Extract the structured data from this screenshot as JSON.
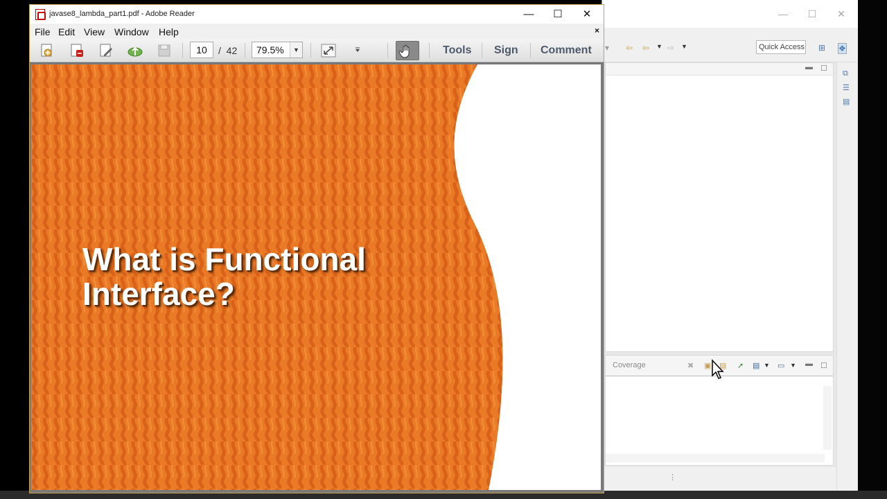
{
  "eclipse": {
    "quick_access": "Quick Access",
    "coverage_tab": "Coverage",
    "window_controls": {
      "minimize": "—",
      "maximize": "☐",
      "close": "✕"
    }
  },
  "reader": {
    "title": "javase8_lambda_part1.pdf - Adobe Reader",
    "window_controls": {
      "minimize": "—",
      "maximize": "☐",
      "close": "✕"
    },
    "menu": {
      "file": "File",
      "edit": "Edit",
      "view": "View",
      "window": "Window",
      "help": "Help",
      "close": "×"
    },
    "toolbar": {
      "page_current": "10",
      "page_separator": "/",
      "page_total": "42",
      "zoom": "79.5%",
      "tools": "Tools",
      "sign": "Sign",
      "comment": "Comment"
    },
    "slide": {
      "title_line1": "What is Functional",
      "title_line2": "Interface?",
      "background_color": "#e8731f",
      "accent_color": "#ffffff"
    }
  }
}
